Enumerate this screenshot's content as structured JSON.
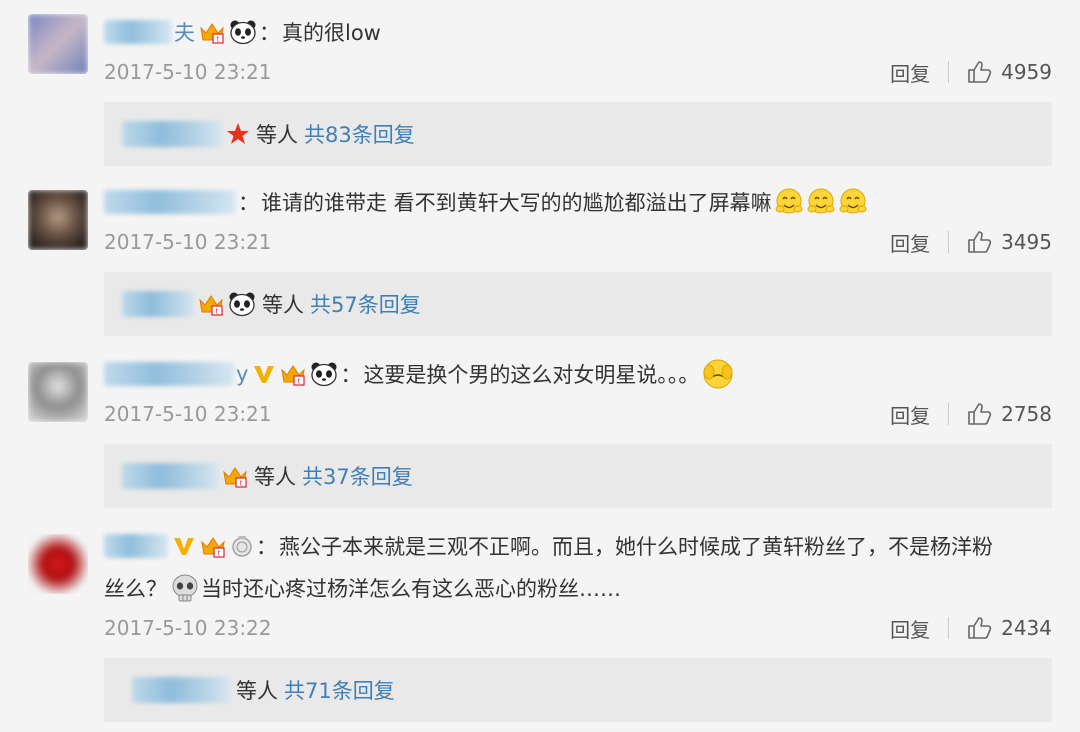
{
  "reply_label": "回复",
  "comments": [
    {
      "user_tail": "夫",
      "text": "真的很low",
      "time": "2017-5-10 23:21",
      "likes": "4959",
      "sub": {
        "text": "等人",
        "link": "共83条回复"
      }
    },
    {
      "user_tail": "",
      "text": "谁请的谁带走  看不到黄轩大写的的尴尬都溢出了屏幕嘛",
      "time": "2017-5-10 23:21",
      "likes": "3495",
      "sub": {
        "text": "等人",
        "link": "共57条回复"
      }
    },
    {
      "user_tail": "y",
      "text": "这要是换个男的这么对女明星说。。。",
      "time": "2017-5-10 23:21",
      "likes": "2758",
      "sub": {
        "text": "等人",
        "link": "共37条回复"
      }
    },
    {
      "user_tail": "",
      "text": "燕公子本来就是三观不正啊。而且，她什么时候成了黄轩粉丝了，不是杨洋粉",
      "text_cont_a": "丝么？",
      "text_cont_b": "当时还心疼过杨洋怎么有这么恶心的粉丝……",
      "time": "2017-5-10 23:22",
      "likes": "2434",
      "sub": {
        "text": "等人",
        "link": "共71条回复"
      }
    }
  ],
  "icons": {
    "crown": "crown-badge-icon",
    "panda": "panda-icon",
    "v": "verified-v-icon",
    "star": "red-star-icon",
    "medal": "medal-icon",
    "skull": "skull-emoji-icon",
    "giggle": "giggle-emoji-icon",
    "cover_face": "cover-face-emoji-icon",
    "thumb": "thumbs-up-icon"
  },
  "colors": {
    "background": "#f4f4f4",
    "sub_panel": "#e9e9e9",
    "link_blue": "#3f7fb5",
    "time_gray": "#999999",
    "verified_gold": "#f5b000"
  }
}
